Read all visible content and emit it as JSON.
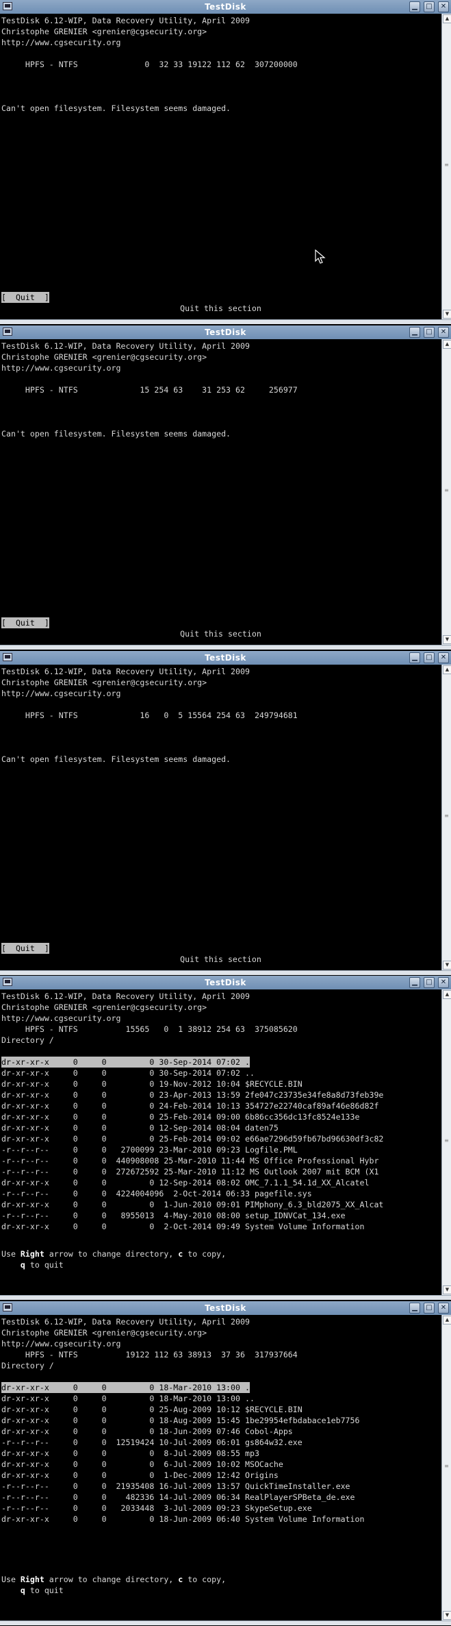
{
  "window_title": "TestDisk",
  "header": {
    "line1": "TestDisk 6.12-WIP, Data Recovery Utility, April 2009",
    "line2": "Christophe GRENIER <grenier@cgsecurity.org>",
    "line3": "http://www.cgsecurity.org"
  },
  "win1": {
    "partition": "     HPFS - NTFS              0  32 33 19122 112 62  307200000",
    "error": "Can't open filesystem. Filesystem seems damaged.",
    "quit_label": "[  Quit  ]",
    "quit_hint": "Quit this section"
  },
  "win2": {
    "partition": "     HPFS - NTFS             15 254 63    31 253 62     256977",
    "error": "Can't open filesystem. Filesystem seems damaged.",
    "quit_label": "[  Quit  ]",
    "quit_hint": "Quit this section"
  },
  "win3": {
    "partition": "     HPFS - NTFS             16   0  5 15564 254 63  249794681",
    "error": "Can't open filesystem. Filesystem seems damaged.",
    "quit_label": "[  Quit  ]",
    "quit_hint": "Quit this section"
  },
  "win4": {
    "partition": "     HPFS - NTFS          15565   0  1 38912 254 63  375085620",
    "directory": "Directory /",
    "entries": [
      "dr-xr-xr-x     0     0         0 30-Sep-2014 07:02 .",
      "dr-xr-xr-x     0     0         0 30-Sep-2014 07:02 ..",
      "dr-xr-xr-x     0     0         0 19-Nov-2012 10:04 $RECYCLE.BIN",
      "dr-xr-xr-x     0     0         0 23-Apr-2013 13:59 2fe047c23735e34fe8a8d73feb39e",
      "dr-xr-xr-x     0     0         0 24-Feb-2014 10:13 354727e22740caf89af46e86d82f",
      "dr-xr-xr-x     0     0         0 25-Feb-2014 09:00 6b86cc356dc13fc8524e133e",
      "dr-xr-xr-x     0     0         0 12-Sep-2014 08:04 daten75",
      "dr-xr-xr-x     0     0         0 25-Feb-2014 09:02 e66ae7296d59fb67bd96630df3c82",
      "-r--r--r--     0     0   2700099 23-Mar-2010 09:23 Logfile.PML",
      "-r--r--r--     0     0  440908008 25-Mar-2010 11:44 MS Office Professional Hybr",
      "-r--r--r--     0     0  272672592 25-Mar-2010 11:12 MS Outlook 2007 mit BCM (X1",
      "dr-xr-xr-x     0     0         0 12-Sep-2014 08:02 OMC_7.1.1_54.1d_XX_Alcatel",
      "-r--r--r--     0     0  4224004096  2-Oct-2014 06:33 pagefile.sys",
      "dr-xr-xr-x     0     0         0  1-Jun-2010 09:01 PIMphony_6.3_bld2075_XX_Alcat",
      "-r--r--r--     0     0   8955013  4-May-2010 08:00 setup_IDNVCat_134.exe",
      "dr-xr-xr-x     0     0         0  2-Oct-2014 09:49 System Volume Information"
    ],
    "help_prefix": "Use ",
    "help_right": "Right",
    "help_mid": " arrow to change directory, ",
    "help_c": "c",
    "help_end": " to copy,",
    "quit_q": "q",
    "quit_text": " to quit"
  },
  "win5": {
    "partition": "     HPFS - NTFS          19122 112 63 38913  37 36  317937664",
    "directory": "Directory /",
    "entries": [
      "dr-xr-xr-x     0     0         0 18-Mar-2010 13:00 .",
      "dr-xr-xr-x     0     0         0 18-Mar-2010 13:00 ..",
      "dr-xr-xr-x     0     0         0 25-Aug-2009 10:12 $RECYCLE.BIN",
      "dr-xr-xr-x     0     0         0 18-Aug-2009 15:45 1be29954efbdabace1eb7756",
      "dr-xr-xr-x     0     0         0 18-Jun-2009 07:46 Cobol-Apps",
      "-r--r--r--     0     0  12519424 10-Jul-2009 06:01 gs864w32.exe",
      "dr-xr-xr-x     0     0         0  8-Jul-2009 08:55 mp3",
      "dr-xr-xr-x     0     0         0  6-Jul-2009 10:02 MSOCache",
      "dr-xr-xr-x     0     0         0  1-Dec-2009 12:42 Origins",
      "-r--r--r--     0     0  21935408 16-Jul-2009 13:57 QuickTimeInstaller.exe",
      "-r--r--r--     0     0    482336 14-Jul-2009 06:34 RealPlayerSPBeta_de.exe",
      "-r--r--r--     0     0   2033448  3-Jul-2009 09:23 SkypeSetup.exe",
      "dr-xr-xr-x     0     0         0 18-Jun-2009 06:40 System Volume Information"
    ],
    "help_prefix": "Use ",
    "help_right": "Right",
    "help_mid": " arrow to change directory, ",
    "help_c": "c",
    "help_end": " to copy,",
    "quit_q": "q",
    "quit_text": " to quit"
  }
}
